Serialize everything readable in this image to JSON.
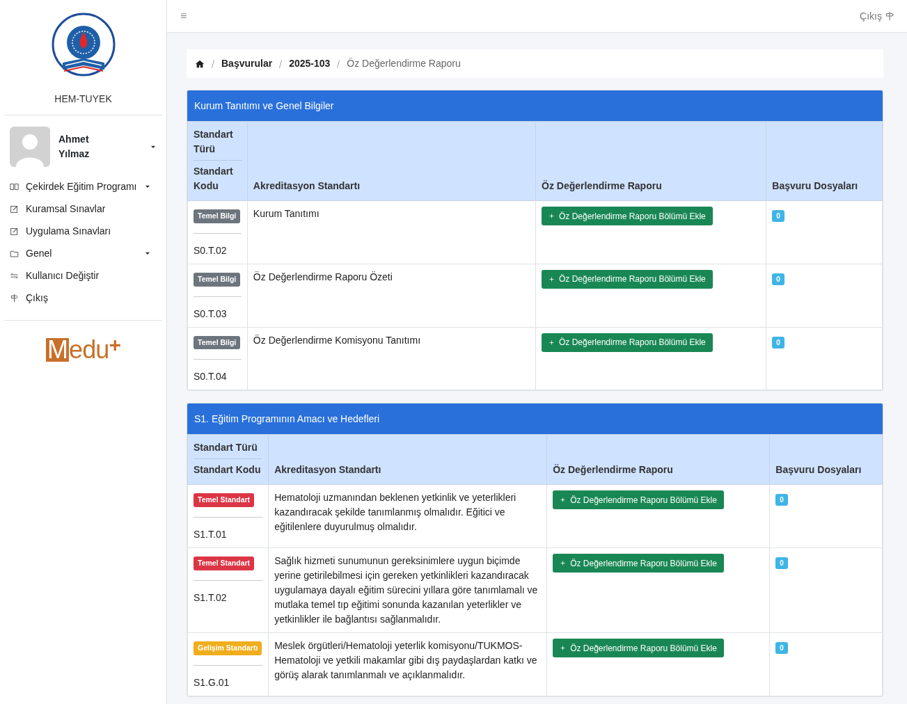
{
  "sidebar": {
    "org_name": "HEM-TUYEK",
    "user": {
      "first_name": "Ahmet",
      "last_name": "Yılmaz",
      "expanded": false
    },
    "items": [
      {
        "kind": "book",
        "label": "Çekirdek Eğitim Programı",
        "has_menu": true
      },
      {
        "kind": "edit",
        "label": "Kuramsal Sınavlar",
        "has_menu": false
      },
      {
        "kind": "edit",
        "label": "Uygulama Sınavları",
        "has_menu": false
      },
      {
        "kind": "folder",
        "label": "Genel",
        "has_menu": true
      },
      {
        "kind": "switch",
        "label": "Kullanıcı Değiştir",
        "has_menu": false
      },
      {
        "kind": "signpost",
        "label": "Çıkış",
        "has_menu": false
      }
    ],
    "brand": {
      "mark": "M",
      "rest": "edu",
      "plus": "+"
    }
  },
  "topbar": {
    "menu_glyph": "≡",
    "logout": "Çıkış"
  },
  "breadcrumb": [
    {
      "label": "Başvurular",
      "current": false
    },
    {
      "label": "2025-103",
      "current": false
    },
    {
      "label": "Öz Değerlendirme Raporu",
      "current": true
    }
  ],
  "sections": [
    {
      "title": "Kurum Tanıtımı ve Genel Bilgiler",
      "columns": {
        "type": "Standart Türü",
        "code": "Standart Kodu",
        "standard": "Akreditasyon Standartı",
        "report": "Öz Değerlendirme Raporu",
        "files": "Başvuru Dosyaları"
      },
      "rows": [
        {
          "kind": "info",
          "badge": "Temel Bilgi",
          "code": "S0.T.02",
          "text": "Kurum Tanıtımı",
          "action": "Öz Değerlendirme Raporu Bölümü Ekle",
          "files": "0"
        },
        {
          "kind": "info",
          "badge": "Temel Bilgi",
          "code": "S0.T.03",
          "text": "Öz Değerlendirme Raporu Özeti",
          "action": "Öz Değerlendirme Raporu Bölümü Ekle",
          "files": "0"
        },
        {
          "kind": "info",
          "badge": "Temel Bilgi",
          "code": "S0.T.04",
          "text": "Öz Değerlendirme Komisyonu Tanıtımı",
          "action": "Öz Değerlendirme Raporu Bölümü Ekle",
          "files": "0"
        }
      ]
    },
    {
      "title": "S1. Eğitim Programının Amacı ve Hedefleri",
      "columns": {
        "type": "Standart Türü",
        "code": "Standart Kodu",
        "standard": "Akreditasyon Standartı",
        "report": "Öz Değerlendirme Raporu",
        "files": "Başvuru Dosyaları"
      },
      "rows": [
        {
          "kind": "basic",
          "badge": "Temel Standart",
          "code": "S1.T.01",
          "text": "Hematoloji uzmanından beklenen yetkinlik ve yeterlikleri kazandıracak şekilde tanımlanmış olmalıdır. Eğitici ve eğitilenlere duyurulmuş olmalıdır.",
          "action": "Öz Değerlendirme Raporu Bölümü Ekle",
          "files": "0"
        },
        {
          "kind": "basic",
          "badge": "Temel Standart",
          "code": "S1.T.02",
          "text": "Sağlık hizmeti sunumunun gereksinimlere uygun biçimde yerine getirilebilmesi için gereken yetkinlikleri kazandıracak uygulamaya dayalı eğitim sürecini yıllara göre tanımlamalı ve mutlaka temel tıp eğitimi sonunda kazanılan yeterlikler ve yetkinlikler ile bağlantısı sağlanmalıdır.",
          "action": "Öz Değerlendirme Raporu Bölümü Ekle",
          "files": "0"
        },
        {
          "kind": "development",
          "badge": "Gelişim Standartı",
          "code": "S1.G.01",
          "text": "Meslek örgütleri/Hematoloji yeterlik komisyonu/TUKMOS-Hematoloji ve yetkili makamlar gibi dış paydaşlardan katkı ve görüş alarak tanımlanmalı ve açıklanmalıdır.",
          "action": "Öz Değerlendirme Raporu Bölümü Ekle",
          "files": "0"
        }
      ]
    }
  ]
}
